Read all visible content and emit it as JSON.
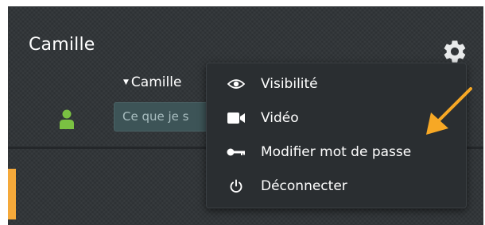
{
  "header": {
    "title": "Camille"
  },
  "user_select": {
    "label": "Camille"
  },
  "status_input": {
    "placeholder": "Ce que je s"
  },
  "menu": {
    "items": [
      {
        "label": "Visibilité",
        "icon": "eye-icon"
      },
      {
        "label": "Vidéo",
        "icon": "video-camera-icon"
      },
      {
        "label": "Modifier mot de passe",
        "icon": "key-icon"
      },
      {
        "label": "Déconnecter",
        "icon": "power-icon"
      }
    ]
  },
  "colors": {
    "panel_bg": "#2f3336",
    "menu_bg": "#2a2e31",
    "accent_orange": "#f5a93a",
    "online_green": "#7ac142",
    "input_bg": "#3d5457"
  }
}
